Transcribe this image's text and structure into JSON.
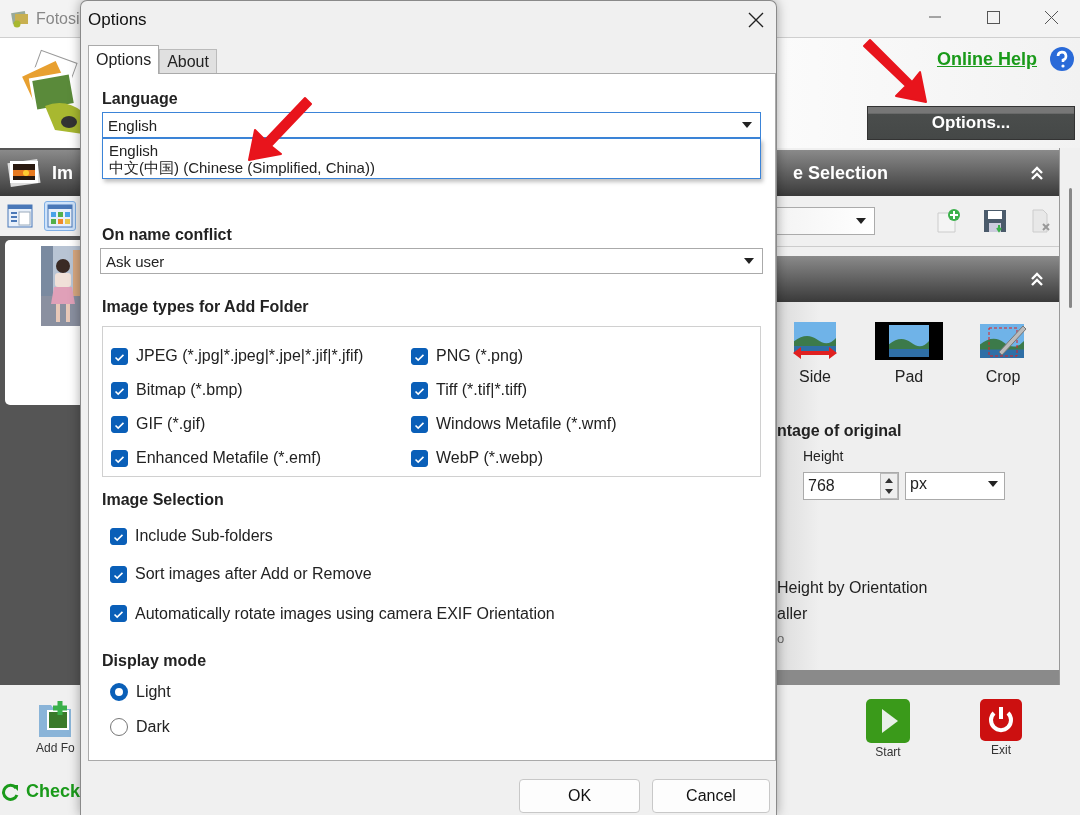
{
  "app_window": {
    "title": "Fotosi",
    "online_help": "Online Help",
    "options_button": "Options...",
    "left_panel": {
      "title": "Im",
      "views": [
        {
          "selected": false
        },
        {
          "selected": true
        }
      ]
    },
    "right_panel": {
      "section_title": "e Selection",
      "modes": [
        {
          "label": "Side",
          "kind": "side"
        },
        {
          "label": "Pad",
          "kind": "pad"
        },
        {
          "label": "Crop",
          "kind": "crop"
        }
      ],
      "resize_label": "ntage of original",
      "height_label": "Height",
      "height_value": "768",
      "unit": "px",
      "option_texts": [
        "Height by Orientation",
        "aller",
        "o"
      ]
    },
    "bottom": {
      "add_folder": "Add Fo",
      "check": "Check",
      "start": "Start",
      "exit": "Exit"
    }
  },
  "options_dialog": {
    "title": "Options",
    "tabs": [
      {
        "label": "Options",
        "selected": true
      },
      {
        "label": "About",
        "selected": false
      }
    ],
    "language": {
      "label": "Language",
      "value": "English",
      "options": [
        "English",
        "中文(中国) (Chinese (Simplified, China))"
      ]
    },
    "name_conflict": {
      "label": "On name conflict",
      "value": "Ask user"
    },
    "image_types": {
      "label": "Image types for Add Folder",
      "items": [
        {
          "label": "JPEG (*.jpg|*.jpeg|*.jpe|*.jif|*.jfif)",
          "checked": true
        },
        {
          "label": "PNG (*.png)",
          "checked": true
        },
        {
          "label": "Bitmap (*.bmp)",
          "checked": true
        },
        {
          "label": "Tiff (*.tif|*.tiff)",
          "checked": true
        },
        {
          "label": "GIF (*.gif)",
          "checked": true
        },
        {
          "label": "Windows Metafile (*.wmf)",
          "checked": true
        },
        {
          "label": "Enhanced Metafile (*.emf)",
          "checked": true
        },
        {
          "label": "WebP (*.webp)",
          "checked": true
        }
      ]
    },
    "image_selection": {
      "label": "Image Selection",
      "items": [
        {
          "label": "Include Sub-folders",
          "checked": true
        },
        {
          "label": "Sort images after Add or Remove",
          "checked": true
        },
        {
          "label": "Automatically rotate images using camera EXIF Orientation",
          "checked": true
        }
      ]
    },
    "display_mode": {
      "label": "Display mode",
      "options": [
        {
          "label": "Light",
          "selected": true
        },
        {
          "label": "Dark",
          "selected": false
        }
      ]
    },
    "buttons": [
      "OK",
      "Cancel"
    ]
  }
}
